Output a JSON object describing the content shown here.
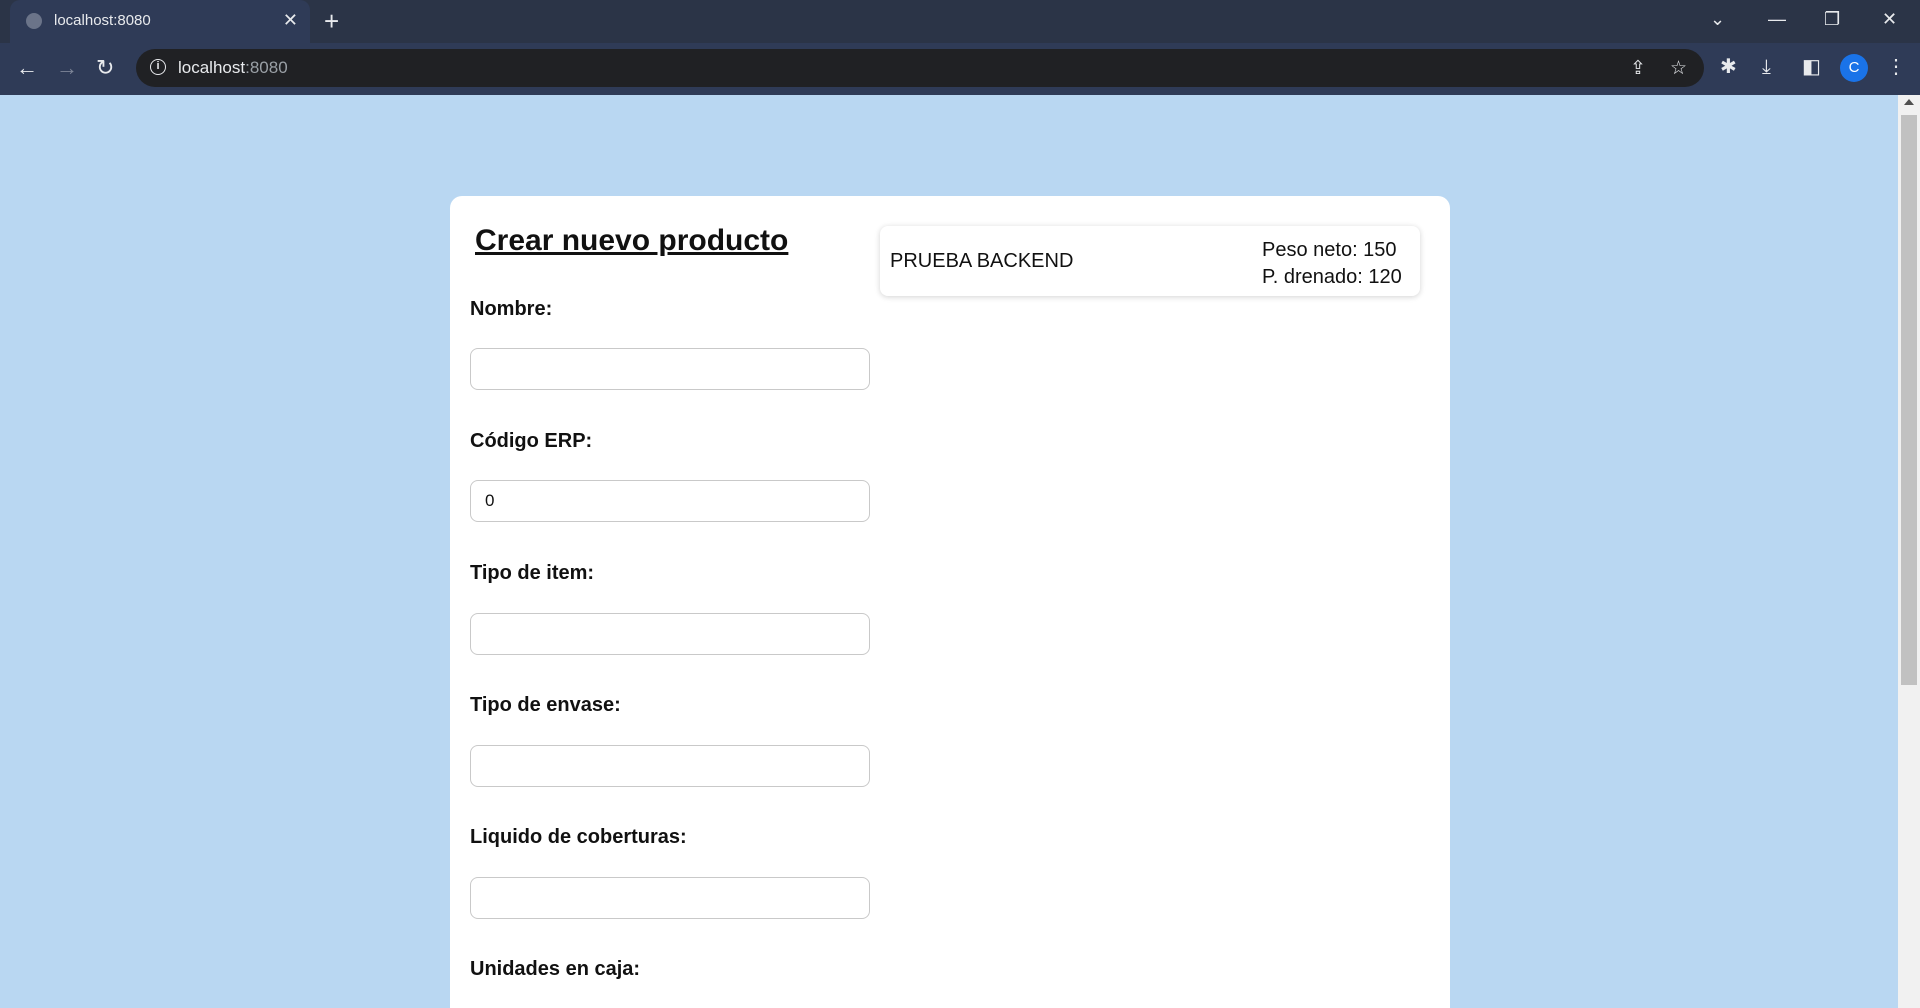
{
  "browser": {
    "tab_title": "localhost:8080",
    "tab_close": "✕",
    "new_tab": "+",
    "url_host": "localhost",
    "url_port": ":8080",
    "profile_initial": "C"
  },
  "form": {
    "title": "Crear nuevo producto",
    "fields": [
      {
        "label": "Nombre:",
        "value": ""
      },
      {
        "label": "Código ERP:",
        "value": "0"
      },
      {
        "label": "Tipo de item:",
        "value": ""
      },
      {
        "label": "Tipo de envase:",
        "value": ""
      },
      {
        "label": "Liquido de coberturas:",
        "value": ""
      },
      {
        "label": "Unidades en caja:",
        "value": ""
      }
    ]
  },
  "product_card": {
    "name": "PRUEBA BACKEND",
    "peso_neto": "Peso neto: 150",
    "peso_drenado": "P. drenado: 120"
  },
  "colors": {
    "page_background": "#b9d7f2",
    "chrome_background": "#2f3b57",
    "avatar": "#1a73e8"
  }
}
